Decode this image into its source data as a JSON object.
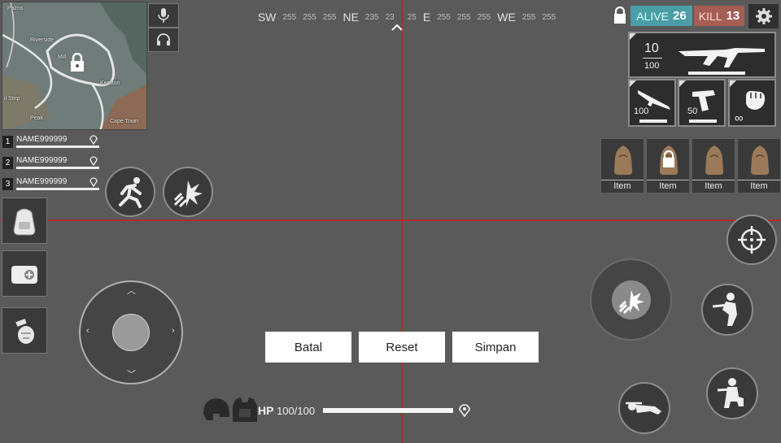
{
  "compass": {
    "items": [
      "SW",
      "255",
      "255",
      "255",
      "NE",
      "235",
      "23",
      "25",
      "E",
      "255",
      "255",
      "255",
      "WE",
      "255",
      "255"
    ]
  },
  "minimap": {
    "labels": [
      "Palms",
      "Riverside",
      "Mill",
      "Keraton",
      "il Strip",
      "Peak",
      "Cape Town"
    ]
  },
  "status": {
    "alive_label": "ALIVE",
    "alive_count": "26",
    "kill_label": "KILL",
    "kill_count": "13"
  },
  "weapons": {
    "primary": {
      "ammo": "10",
      "reserve": "100"
    },
    "secondary": {
      "ammo": "100"
    },
    "pistol": {
      "ammo": "50"
    },
    "melee": {
      "ammo": "∞"
    }
  },
  "items": [
    "Item",
    "Item",
    "Item",
    "Item"
  ],
  "players": [
    {
      "num": "1",
      "name": "NAME999999"
    },
    {
      "num": "2",
      "name": "NAME999999"
    },
    {
      "num": "3",
      "name": "NAME999999"
    }
  ],
  "buttons": {
    "cancel": "Batal",
    "reset": "Reset",
    "save": "Simpan"
  },
  "hp": {
    "label": "HP",
    "value": "100/100"
  },
  "colors": {
    "guide": "#b52a2a",
    "alive": "#4a9ea5",
    "kill": "#a65d53"
  }
}
